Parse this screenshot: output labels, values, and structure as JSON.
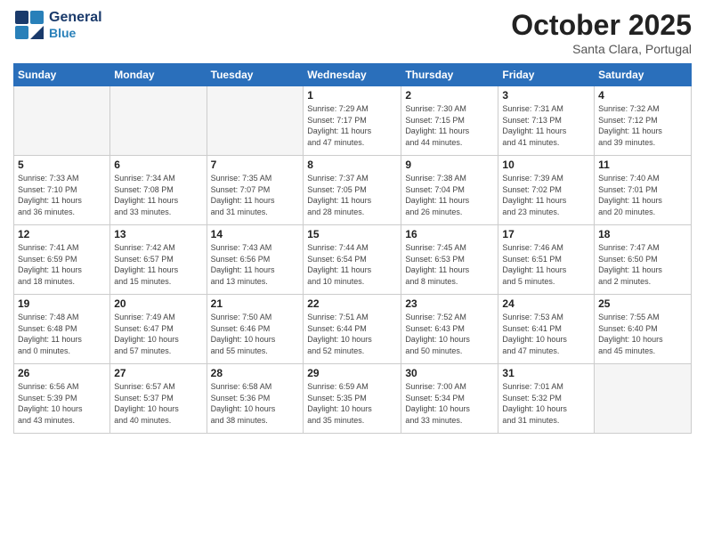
{
  "logo": {
    "line1": "General",
    "line2": "Blue"
  },
  "header": {
    "month_year": "October 2025",
    "location": "Santa Clara, Portugal"
  },
  "weekdays": [
    "Sunday",
    "Monday",
    "Tuesday",
    "Wednesday",
    "Thursday",
    "Friday",
    "Saturday"
  ],
  "weeks": [
    [
      {
        "day": "",
        "info": "",
        "empty": true
      },
      {
        "day": "",
        "info": "",
        "empty": true
      },
      {
        "day": "",
        "info": "",
        "empty": true
      },
      {
        "day": "1",
        "info": "Sunrise: 7:29 AM\nSunset: 7:17 PM\nDaylight: 11 hours\nand 47 minutes.",
        "empty": false
      },
      {
        "day": "2",
        "info": "Sunrise: 7:30 AM\nSunset: 7:15 PM\nDaylight: 11 hours\nand 44 minutes.",
        "empty": false
      },
      {
        "day": "3",
        "info": "Sunrise: 7:31 AM\nSunset: 7:13 PM\nDaylight: 11 hours\nand 41 minutes.",
        "empty": false
      },
      {
        "day": "4",
        "info": "Sunrise: 7:32 AM\nSunset: 7:12 PM\nDaylight: 11 hours\nand 39 minutes.",
        "empty": false
      }
    ],
    [
      {
        "day": "5",
        "info": "Sunrise: 7:33 AM\nSunset: 7:10 PM\nDaylight: 11 hours\nand 36 minutes.",
        "empty": false
      },
      {
        "day": "6",
        "info": "Sunrise: 7:34 AM\nSunset: 7:08 PM\nDaylight: 11 hours\nand 33 minutes.",
        "empty": false
      },
      {
        "day": "7",
        "info": "Sunrise: 7:35 AM\nSunset: 7:07 PM\nDaylight: 11 hours\nand 31 minutes.",
        "empty": false
      },
      {
        "day": "8",
        "info": "Sunrise: 7:37 AM\nSunset: 7:05 PM\nDaylight: 11 hours\nand 28 minutes.",
        "empty": false
      },
      {
        "day": "9",
        "info": "Sunrise: 7:38 AM\nSunset: 7:04 PM\nDaylight: 11 hours\nand 26 minutes.",
        "empty": false
      },
      {
        "day": "10",
        "info": "Sunrise: 7:39 AM\nSunset: 7:02 PM\nDaylight: 11 hours\nand 23 minutes.",
        "empty": false
      },
      {
        "day": "11",
        "info": "Sunrise: 7:40 AM\nSunset: 7:01 PM\nDaylight: 11 hours\nand 20 minutes.",
        "empty": false
      }
    ],
    [
      {
        "day": "12",
        "info": "Sunrise: 7:41 AM\nSunset: 6:59 PM\nDaylight: 11 hours\nand 18 minutes.",
        "empty": false
      },
      {
        "day": "13",
        "info": "Sunrise: 7:42 AM\nSunset: 6:57 PM\nDaylight: 11 hours\nand 15 minutes.",
        "empty": false
      },
      {
        "day": "14",
        "info": "Sunrise: 7:43 AM\nSunset: 6:56 PM\nDaylight: 11 hours\nand 13 minutes.",
        "empty": false
      },
      {
        "day": "15",
        "info": "Sunrise: 7:44 AM\nSunset: 6:54 PM\nDaylight: 11 hours\nand 10 minutes.",
        "empty": false
      },
      {
        "day": "16",
        "info": "Sunrise: 7:45 AM\nSunset: 6:53 PM\nDaylight: 11 hours\nand 8 minutes.",
        "empty": false
      },
      {
        "day": "17",
        "info": "Sunrise: 7:46 AM\nSunset: 6:51 PM\nDaylight: 11 hours\nand 5 minutes.",
        "empty": false
      },
      {
        "day": "18",
        "info": "Sunrise: 7:47 AM\nSunset: 6:50 PM\nDaylight: 11 hours\nand 2 minutes.",
        "empty": false
      }
    ],
    [
      {
        "day": "19",
        "info": "Sunrise: 7:48 AM\nSunset: 6:48 PM\nDaylight: 11 hours\nand 0 minutes.",
        "empty": false
      },
      {
        "day": "20",
        "info": "Sunrise: 7:49 AM\nSunset: 6:47 PM\nDaylight: 10 hours\nand 57 minutes.",
        "empty": false
      },
      {
        "day": "21",
        "info": "Sunrise: 7:50 AM\nSunset: 6:46 PM\nDaylight: 10 hours\nand 55 minutes.",
        "empty": false
      },
      {
        "day": "22",
        "info": "Sunrise: 7:51 AM\nSunset: 6:44 PM\nDaylight: 10 hours\nand 52 minutes.",
        "empty": false
      },
      {
        "day": "23",
        "info": "Sunrise: 7:52 AM\nSunset: 6:43 PM\nDaylight: 10 hours\nand 50 minutes.",
        "empty": false
      },
      {
        "day": "24",
        "info": "Sunrise: 7:53 AM\nSunset: 6:41 PM\nDaylight: 10 hours\nand 47 minutes.",
        "empty": false
      },
      {
        "day": "25",
        "info": "Sunrise: 7:55 AM\nSunset: 6:40 PM\nDaylight: 10 hours\nand 45 minutes.",
        "empty": false
      }
    ],
    [
      {
        "day": "26",
        "info": "Sunrise: 6:56 AM\nSunset: 5:39 PM\nDaylight: 10 hours\nand 43 minutes.",
        "empty": false
      },
      {
        "day": "27",
        "info": "Sunrise: 6:57 AM\nSunset: 5:37 PM\nDaylight: 10 hours\nand 40 minutes.",
        "empty": false
      },
      {
        "day": "28",
        "info": "Sunrise: 6:58 AM\nSunset: 5:36 PM\nDaylight: 10 hours\nand 38 minutes.",
        "empty": false
      },
      {
        "day": "29",
        "info": "Sunrise: 6:59 AM\nSunset: 5:35 PM\nDaylight: 10 hours\nand 35 minutes.",
        "empty": false
      },
      {
        "day": "30",
        "info": "Sunrise: 7:00 AM\nSunset: 5:34 PM\nDaylight: 10 hours\nand 33 minutes.",
        "empty": false
      },
      {
        "day": "31",
        "info": "Sunrise: 7:01 AM\nSunset: 5:32 PM\nDaylight: 10 hours\nand 31 minutes.",
        "empty": false
      },
      {
        "day": "",
        "info": "",
        "empty": true
      }
    ]
  ]
}
